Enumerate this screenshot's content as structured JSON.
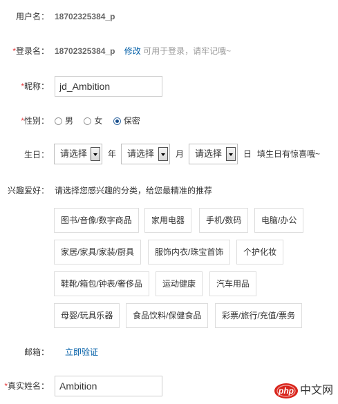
{
  "username": {
    "label": "用户名：",
    "value": "18702325384_p"
  },
  "login_name": {
    "required_mark": "*",
    "label": "登录名：",
    "value": "18702325384_p",
    "edit_link": "修改",
    "hint": "可用于登录，请牢记哦~"
  },
  "nickname": {
    "required_mark": "*",
    "label": "昵称：",
    "value": "jd_Ambition"
  },
  "gender": {
    "required_mark": "*",
    "label": "性别：",
    "options": [
      {
        "label": "男",
        "checked": false
      },
      {
        "label": "女",
        "checked": false
      },
      {
        "label": "保密",
        "checked": true
      }
    ]
  },
  "birthday": {
    "label": "生日：",
    "year": {
      "value": "请选择",
      "unit": "年"
    },
    "month": {
      "value": "请选择",
      "unit": "月"
    },
    "day": {
      "value": "请选择",
      "unit": "日"
    },
    "hint": "填生日有惊喜哦~"
  },
  "interests": {
    "label": "兴趣爱好：",
    "prompt": "请选择您感兴趣的分类，给您最精准的推荐",
    "rows": [
      [
        "图书/音像/数字商品",
        "家用电器",
        "手机/数码",
        "电脑/办公"
      ],
      [
        "家居/家具/家装/厨具",
        "服饰内衣/珠宝首饰",
        "个护化妆"
      ],
      [
        "鞋靴/箱包/钟表/奢侈品",
        "运动健康",
        "汽车用品"
      ],
      [
        "母婴/玩具乐器",
        "食品饮料/保健食品",
        "彩票/旅行/充值/票务"
      ]
    ]
  },
  "email": {
    "label": "邮箱：",
    "verify_link": "立即验证"
  },
  "real_name": {
    "required_mark": "*",
    "label": "真实姓名：",
    "value": "Ambition"
  },
  "watermark": {
    "text": "中文网",
    "logo_letters": "php"
  },
  "colors": {
    "required": "#e4393c",
    "link": "#005ea7",
    "hint": "#999999",
    "border": "#cccccc",
    "watermark_red": "#d9251c"
  }
}
